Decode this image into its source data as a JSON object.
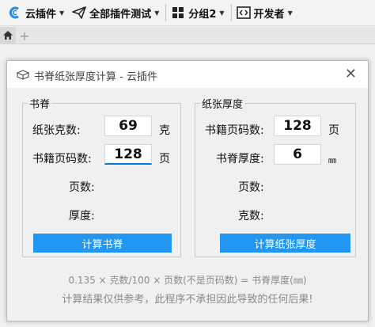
{
  "toolbar": {
    "items": [
      {
        "label": "云插件",
        "icon": "cloud-plugin-logo-icon"
      },
      {
        "label": "全部插件测试",
        "icon": "paper-plane-icon"
      },
      {
        "label": "分组2",
        "icon": "grid-icon"
      },
      {
        "label": "开发者",
        "icon": "code-icon"
      }
    ]
  },
  "tabs": {
    "home_icon": "home-icon",
    "add_icon": "plus-icon"
  },
  "dialog": {
    "title": "书脊纸张厚度计算 - 云插件",
    "close": "✕",
    "spine": {
      "group_label": "书脊",
      "paper_weight_label": "纸张克数:",
      "paper_weight_value": "69",
      "paper_weight_unit": "克",
      "page_count_label": "书籍页码数:",
      "page_count_value": "128",
      "page_count_unit": "页",
      "pages_label": "页数:",
      "thickness_label": "厚度:",
      "button": "计算书脊"
    },
    "paper": {
      "group_label": "纸张厚度",
      "page_count_label": "书籍页码数:",
      "page_count_value": "128",
      "page_count_unit": "页",
      "spine_thickness_label": "书脊厚度:",
      "spine_thickness_value": "6",
      "spine_thickness_unit": "㎜",
      "pages_label": "页数:",
      "weight_label": "克数:",
      "button": "计算纸张厚度"
    },
    "formula": "0.135 × 克数/100 × 页数(不是页码数) = 书脊厚度(㎜)",
    "disclaimer": "计算结果仅供参考，此程序不承担因此导致的任何后果!"
  },
  "colors": {
    "accent": "#2196f3",
    "input_focus": "#0078d7"
  }
}
